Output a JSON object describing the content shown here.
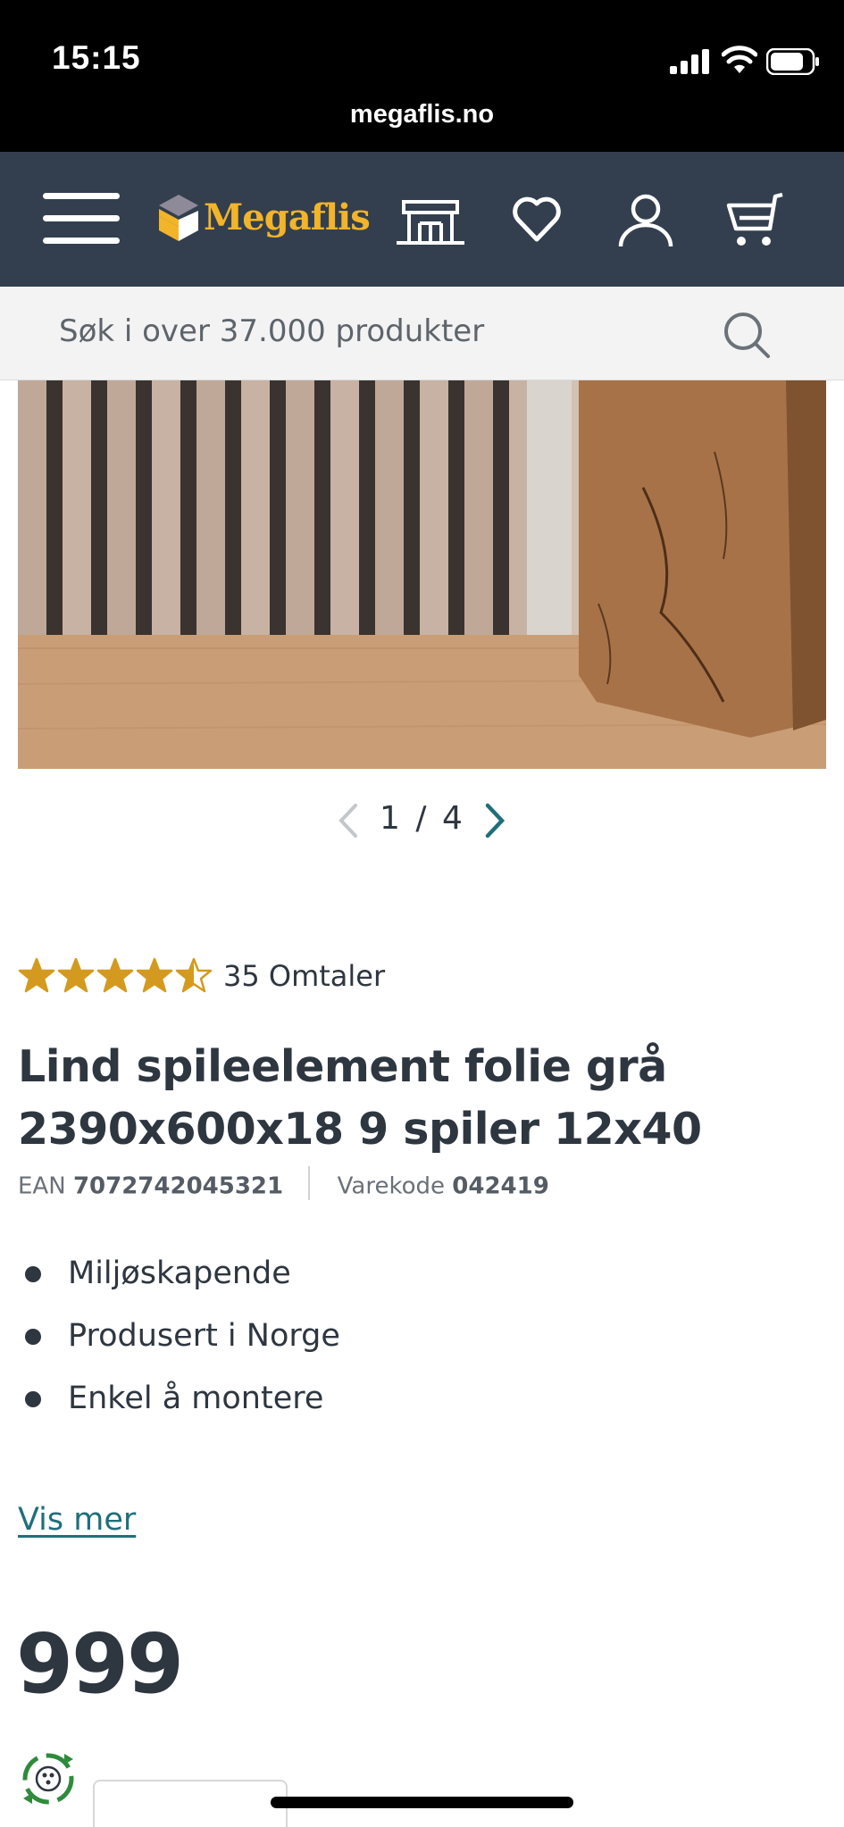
{
  "status_bar": {
    "time": "15:15",
    "url": "megaflis.no"
  },
  "header": {
    "logo_text": "Megaflis",
    "icons": [
      "menu-icon",
      "showroom-icon",
      "heart-icon",
      "user-icon",
      "cart-icon"
    ],
    "background": "#333f4e",
    "logo_color": "#f2b429"
  },
  "search": {
    "placeholder": "Søk i over 37.000 produkter"
  },
  "gallery": {
    "current": "1",
    "separator": "/",
    "total": "4"
  },
  "product": {
    "rating": 4.5,
    "reviews": "35 Omtaler",
    "title_line1": "Lind spileelement folie grå",
    "title_line2": "2390x600x18 9 spiler 12x40",
    "ean_label": "EAN",
    "ean": "7072742045321",
    "sku_label": "Varekode",
    "sku": "042419",
    "features": [
      "Miljøskapende",
      "Produsert i Norge",
      "Enkel å montere"
    ],
    "show_more": "Vis mer",
    "price": "999"
  },
  "colors": {
    "star": "#d49a1f",
    "link": "#1f6f7a",
    "text": "#2e3640"
  }
}
